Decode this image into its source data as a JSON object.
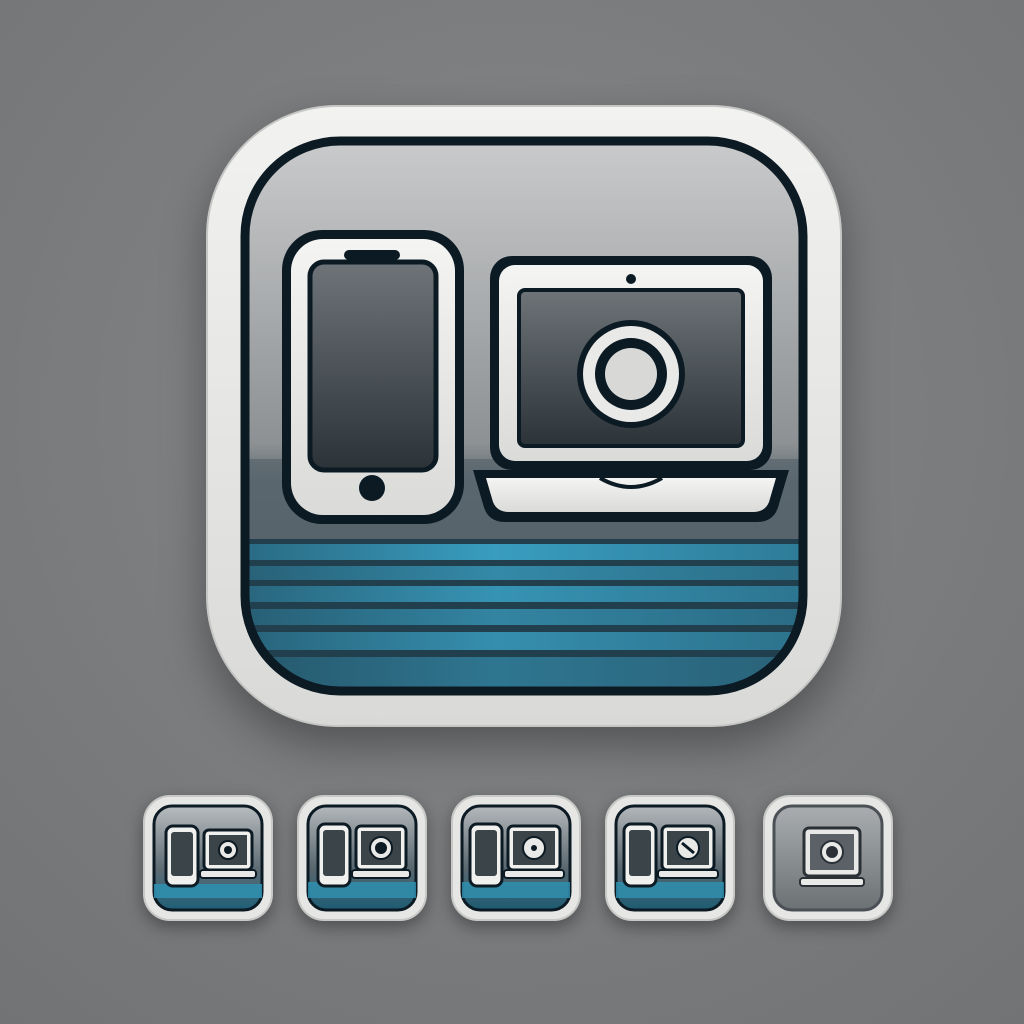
{
  "scene": {
    "background_color": "#7d7f81",
    "description_items": [
      "main-app-icon",
      "icon-variants"
    ]
  },
  "main_icon": {
    "name": "phone-and-laptop-app-icon",
    "frame_color": "#e7e7e5",
    "outline_color": "#0c1a24",
    "accent_color": "#2f8fae",
    "glyphs": [
      "smartphone-icon",
      "laptop-icon",
      "record-button-icon"
    ]
  },
  "variants": [
    {
      "name": "variant-1",
      "style": "blue-phone-laptop",
      "laptop_symbol": "ring"
    },
    {
      "name": "variant-2",
      "style": "blue-phone-laptop",
      "laptop_symbol": "ring"
    },
    {
      "name": "variant-3",
      "style": "blue-phone-laptop",
      "laptop_symbol": "dot-ring"
    },
    {
      "name": "variant-4",
      "style": "blue-phone-laptop",
      "laptop_symbol": "slash-ring"
    },
    {
      "name": "variant-5",
      "style": "gray-laptop-only",
      "laptop_symbol": "ring"
    }
  ]
}
